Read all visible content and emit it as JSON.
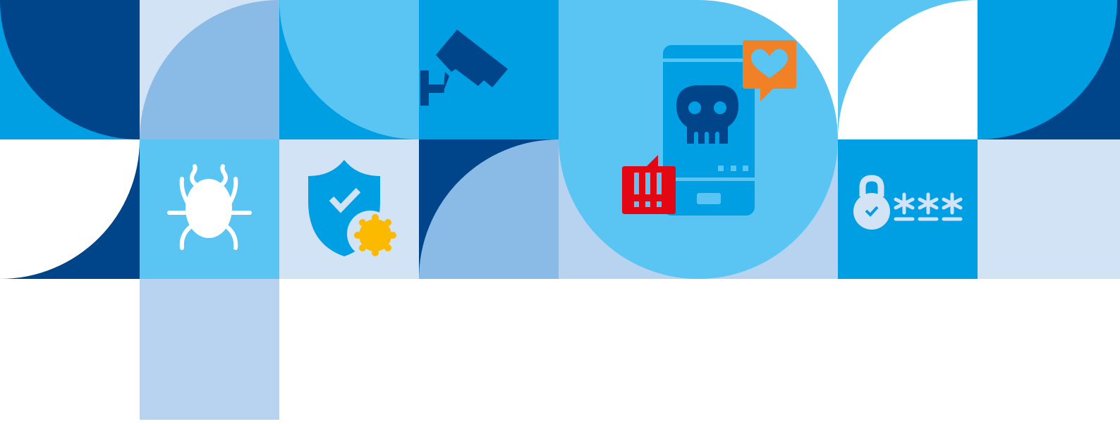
{
  "palette": {
    "navy": "#00458a",
    "blue": "#009fe3",
    "sky": "#5ac4f2",
    "periwinkle": "#8abbe6",
    "pale": "#d3e3f6",
    "paleMid": "#b7d3ef",
    "white": "#ffffff",
    "alertRed": "#e30613",
    "alertOrange": "#f08127",
    "badgeYellow": "#fbba00"
  },
  "icons": [
    {
      "name": "bug-icon"
    },
    {
      "name": "shield-check-icon"
    },
    {
      "name": "security-camera-icon"
    },
    {
      "name": "malware-phone-icon"
    },
    {
      "name": "heart-message-icon"
    },
    {
      "name": "alert-message-icon"
    },
    {
      "name": "password-lock-icon"
    }
  ]
}
